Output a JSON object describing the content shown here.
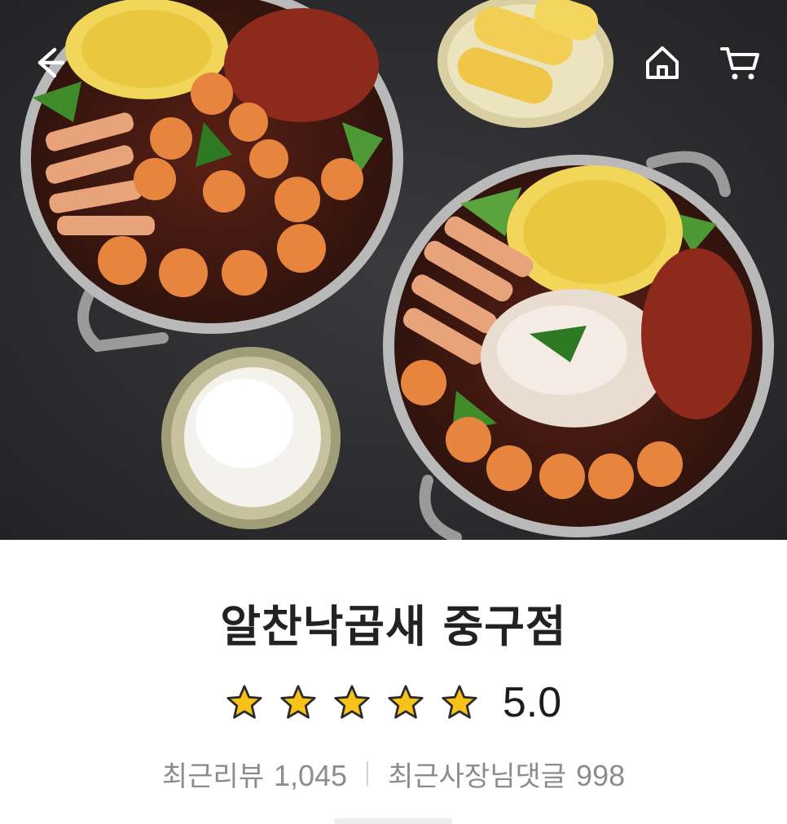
{
  "header": {
    "back_icon": "arrow-left-icon",
    "home_icon": "home-icon",
    "cart_icon": "cart-icon"
  },
  "hero": {
    "image": "hero-food-photo"
  },
  "store": {
    "name": "알찬낙곱새 중구점",
    "rating": "5.0",
    "rating_stars": 5,
    "recent_review_label": "최근리뷰",
    "recent_review_count": "1,045",
    "owner_reply_label": "최근사장님댓글",
    "owner_reply_count": "998"
  },
  "colors": {
    "star_fill": "#F7C21A",
    "star_outline": "#2a2a2a",
    "title": "#222222",
    "muted": "#8c8c8c"
  }
}
